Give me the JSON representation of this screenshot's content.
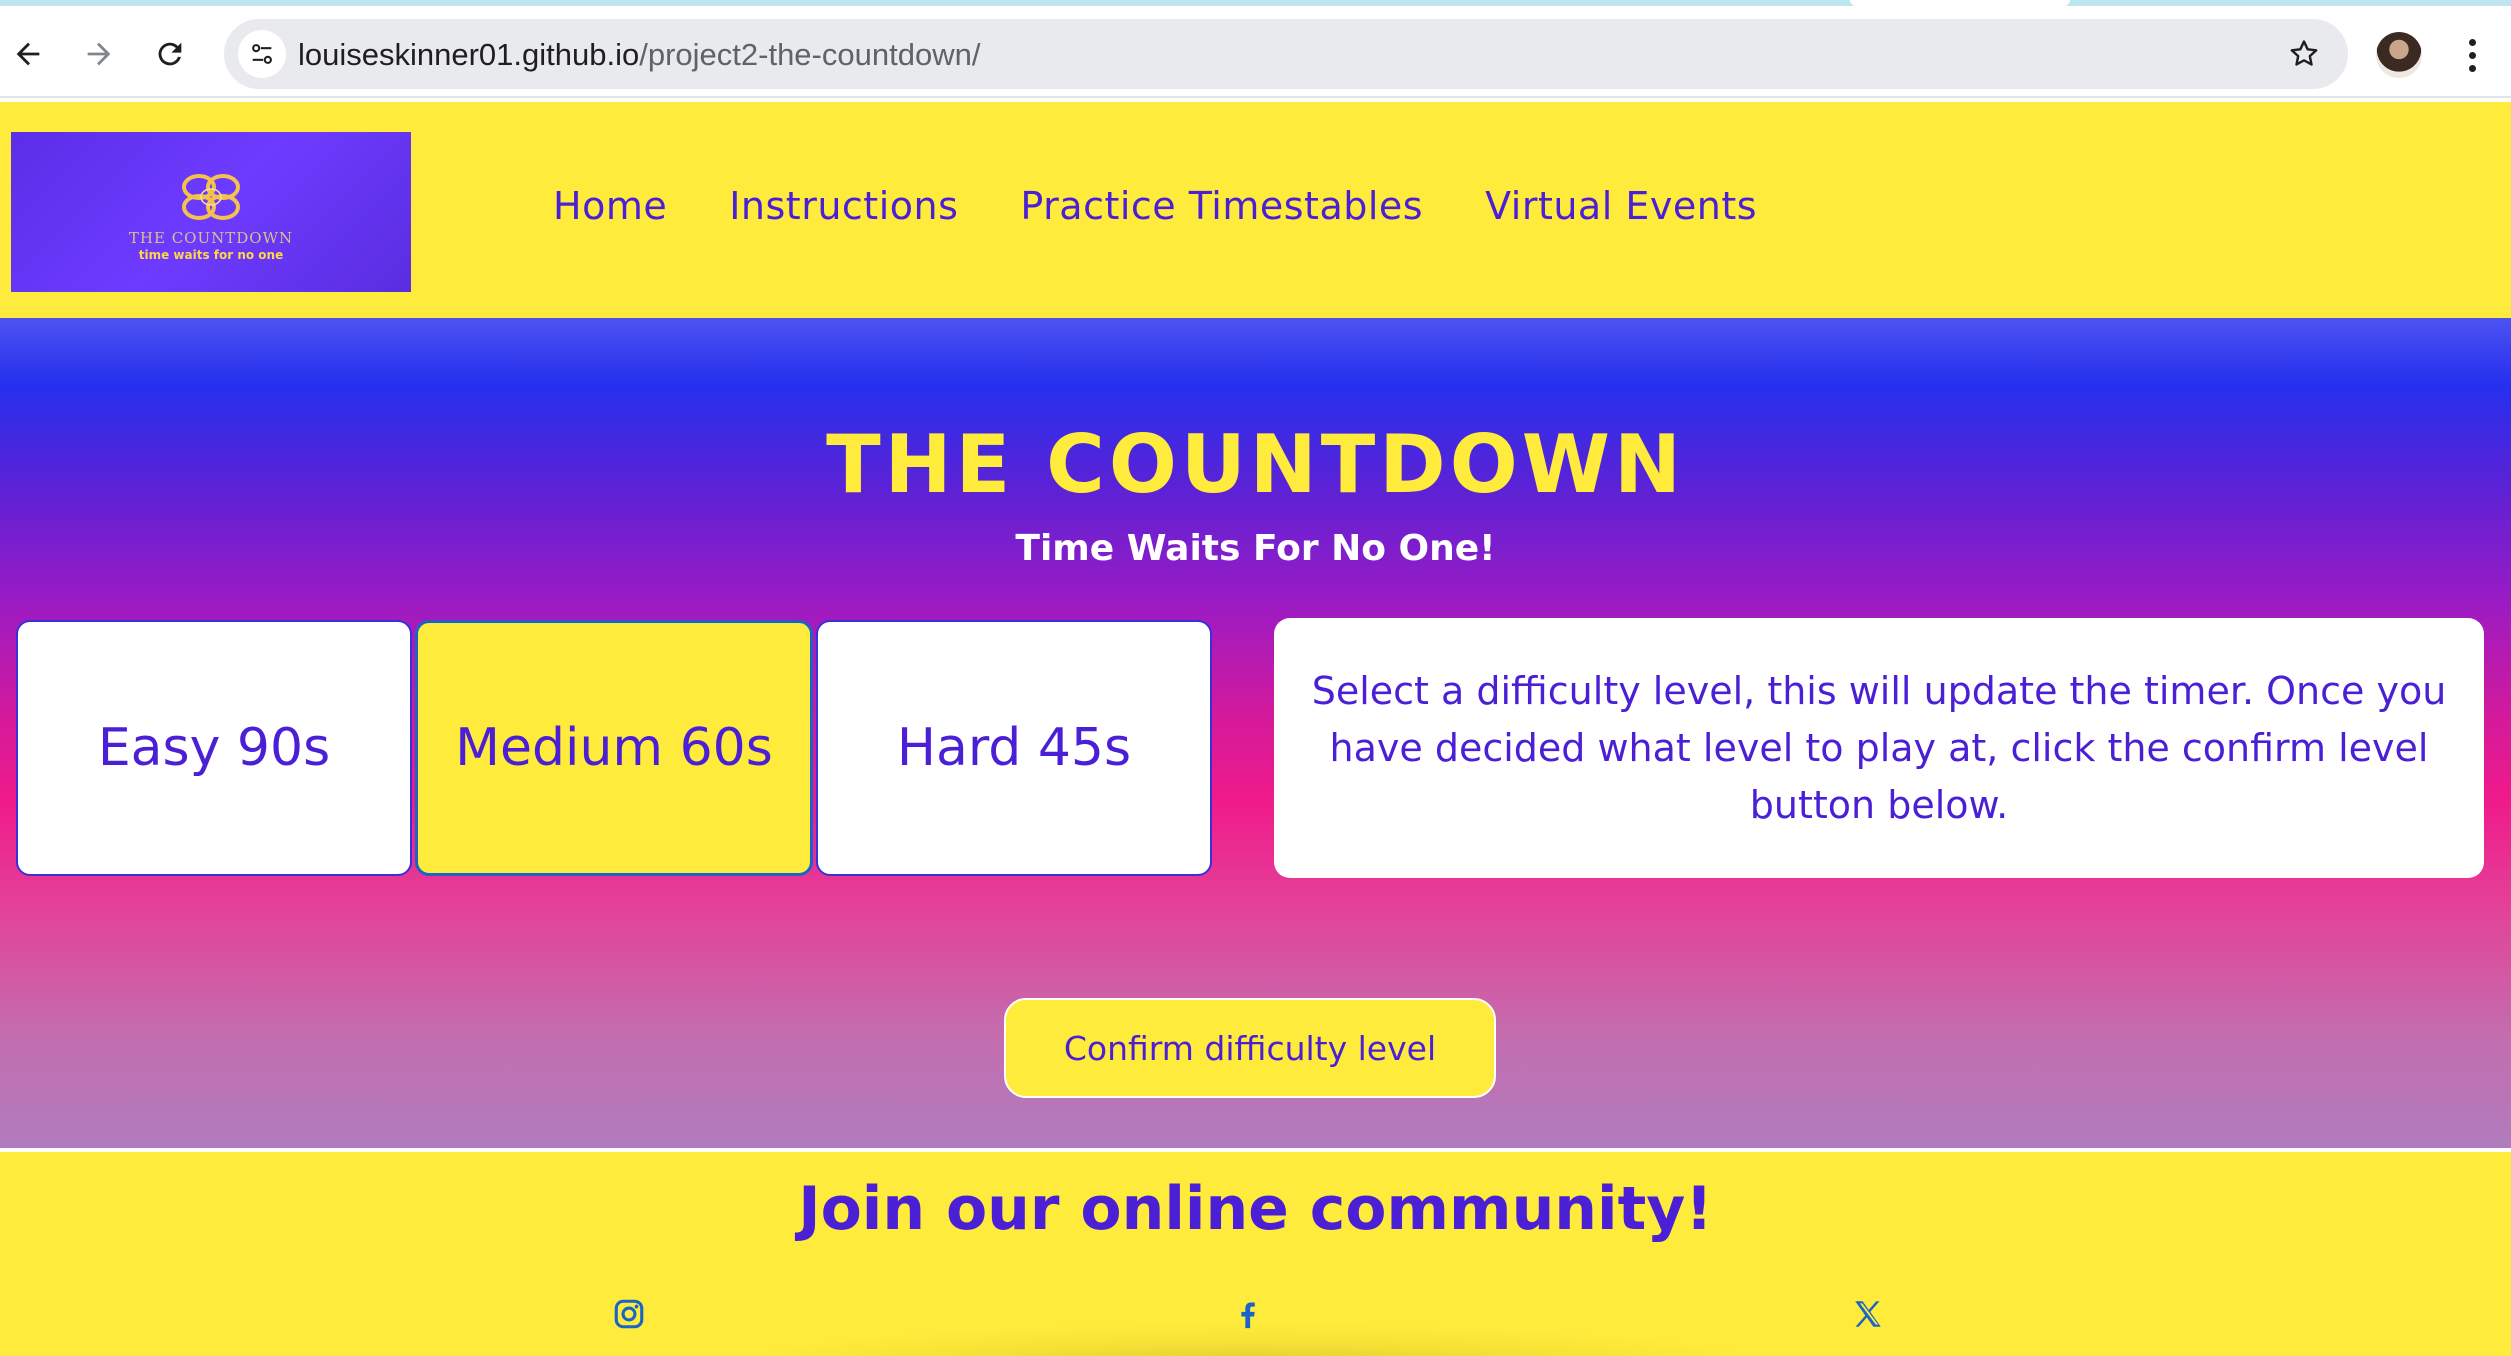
{
  "browser": {
    "url_host": "louiseskinner01.github.io",
    "url_path": "/project2-the-countdown/",
    "icons": [
      "back-arrow-icon",
      "forward-arrow-icon",
      "reload-icon",
      "site-info-icon",
      "bookmark-star-icon",
      "profile-avatar",
      "more-menu-icon"
    ]
  },
  "header": {
    "logo": {
      "title": "THE COUNTDOWN",
      "tagline": "time waits for no one",
      "icon": "infinity-knot-icon"
    },
    "nav": [
      {
        "label": "Home"
      },
      {
        "label": "Instructions"
      },
      {
        "label": "Practice Timestables"
      },
      {
        "label": "Virtual Events"
      }
    ]
  },
  "hero": {
    "title": "THE COUNTDOWN",
    "subtitle": "Time Waits For No One!",
    "levels": [
      {
        "label": "Easy 90s",
        "selected": false
      },
      {
        "label": "Medium 60s",
        "selected": true
      },
      {
        "label": "Hard 45s",
        "selected": false
      }
    ],
    "instructions": "Select a difficulty level, this will update the timer. Once you have decided what level to play at, click the confirm level button below.",
    "confirm_label": "Confirm difficulty level"
  },
  "footer": {
    "title": "Join our online community!",
    "social": [
      {
        "icon": "instagram-icon"
      },
      {
        "icon": "facebook-icon"
      },
      {
        "icon": "x-twitter-icon"
      }
    ]
  },
  "colors": {
    "brand_yellow": "#ffeb3b",
    "brand_purple": "#4a1fd6",
    "gradient_top": "#2530ee",
    "gradient_mid": "#f01a8a",
    "selected_border": "#1a64c8",
    "social_icon": "#1a64c8"
  }
}
